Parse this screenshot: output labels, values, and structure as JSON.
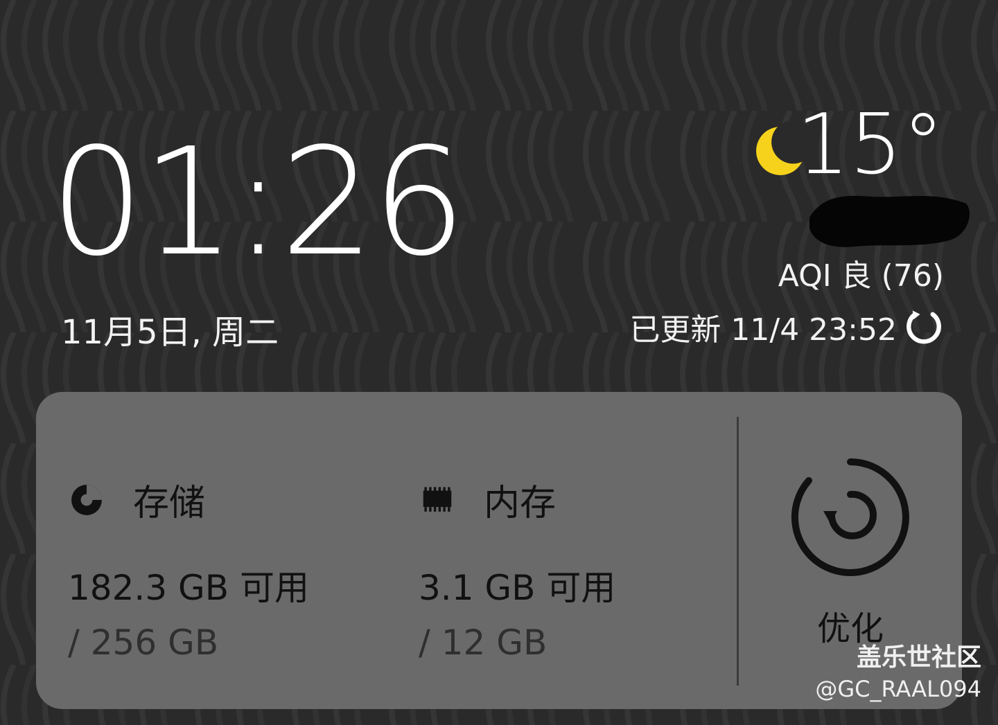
{
  "clock": {
    "time": "01:26",
    "date": "11月5日, 周二"
  },
  "weather": {
    "temperature": "15°",
    "aqi": "AQI 良 (76)",
    "updated": "已更新 11/4 23:52",
    "icons": [
      "moon-icon",
      "refresh-icon"
    ],
    "accent_color": "#f6d21c"
  },
  "card": {
    "storage": {
      "title": "存储",
      "value": "182.3 GB 可用",
      "total": "/ 256 GB",
      "icon": "pie-chart-icon"
    },
    "memory": {
      "title": "内存",
      "value": "3.1 GB 可用",
      "total": "/ 12 GB",
      "icon": "memory-chip-icon"
    },
    "optimize": {
      "label": "优化",
      "icon": "optimize-icon"
    }
  },
  "watermark": {
    "main": "盖乐世社区",
    "sub": "@GC_RAAL094"
  }
}
